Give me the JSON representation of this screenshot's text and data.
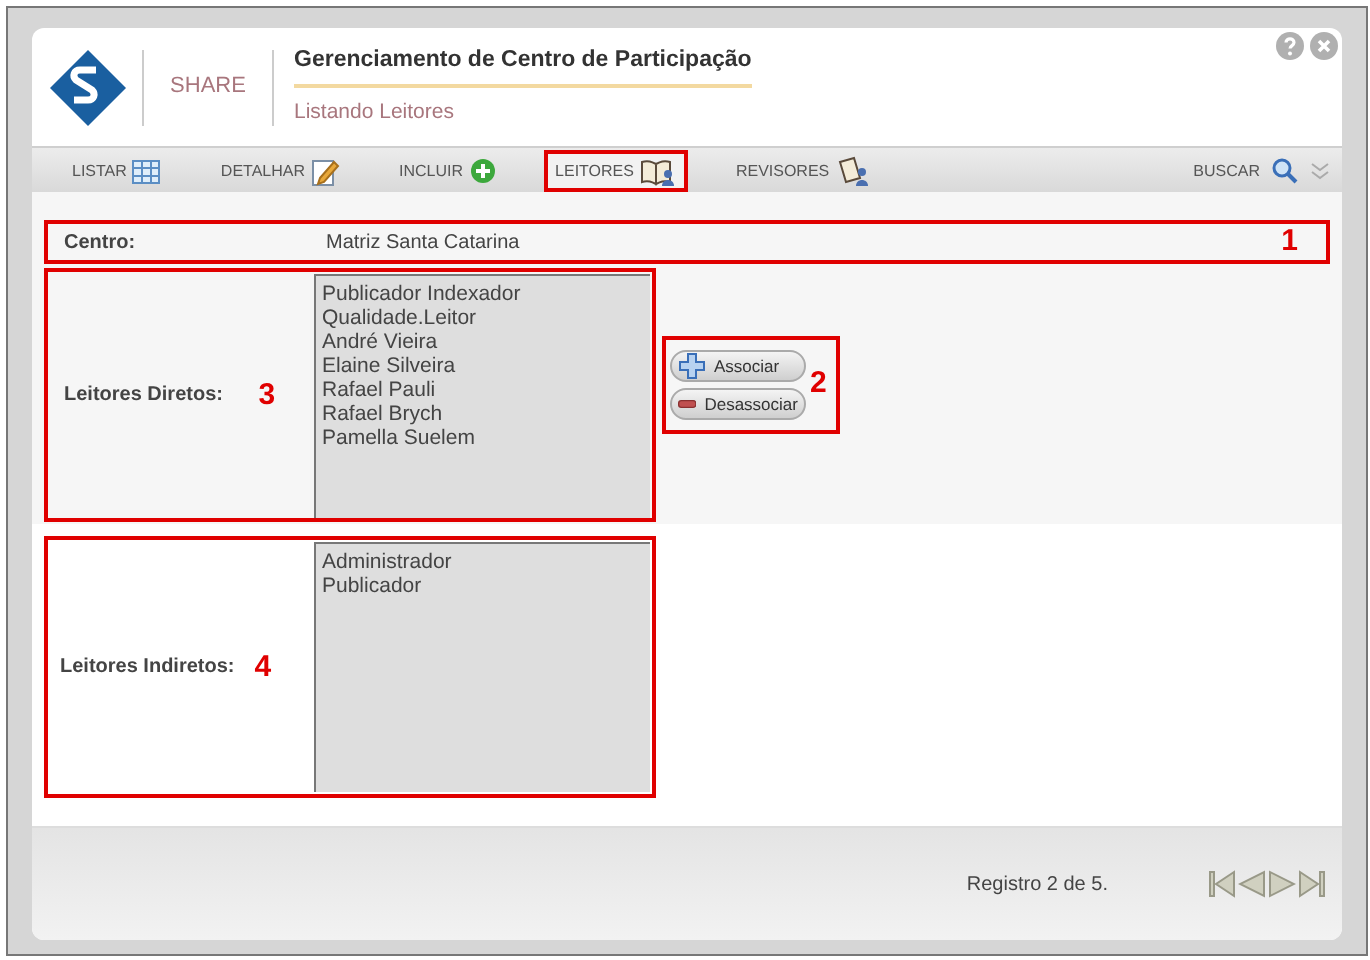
{
  "header": {
    "brand": "SHARE",
    "title": "Gerenciamento de Centro de Participação",
    "subtitle": "Listando Leitores"
  },
  "tabs": [
    {
      "label": "LISTAR",
      "kind": "table",
      "selected": false,
      "outlined": false
    },
    {
      "label": "DETALHAR",
      "kind": "edit",
      "selected": false,
      "outlined": false
    },
    {
      "label": "INCLUIR",
      "kind": "add",
      "selected": false,
      "outlined": false
    },
    {
      "label": "LEITORES",
      "kind": "book",
      "selected": true,
      "outlined": true
    },
    {
      "label": "REVISORES",
      "kind": "review",
      "selected": false,
      "outlined": false
    }
  ],
  "search": {
    "label": "BUSCAR"
  },
  "centro": {
    "label": "Centro:",
    "value": "Matriz Santa Catarina",
    "callout": "1"
  },
  "diretos": {
    "label": "Leitores Diretos:",
    "callout": "3",
    "items": [
      "Publicador Indexador",
      "Qualidade.Leitor",
      "André Vieira",
      "Elaine Silveira",
      "Rafael Pauli",
      "Rafael Brych",
      "Pamella Suelem"
    ]
  },
  "actions": {
    "callout": "2",
    "buttons": [
      {
        "label": "Associar",
        "kind": "add"
      },
      {
        "label": "Desassociar",
        "kind": "remove"
      }
    ]
  },
  "indiretos": {
    "label": "Leitores Indiretos:",
    "callout": "4",
    "items": [
      "Administrador",
      "Publicador"
    ]
  },
  "footer": {
    "record": "Registro 2 de 5."
  }
}
